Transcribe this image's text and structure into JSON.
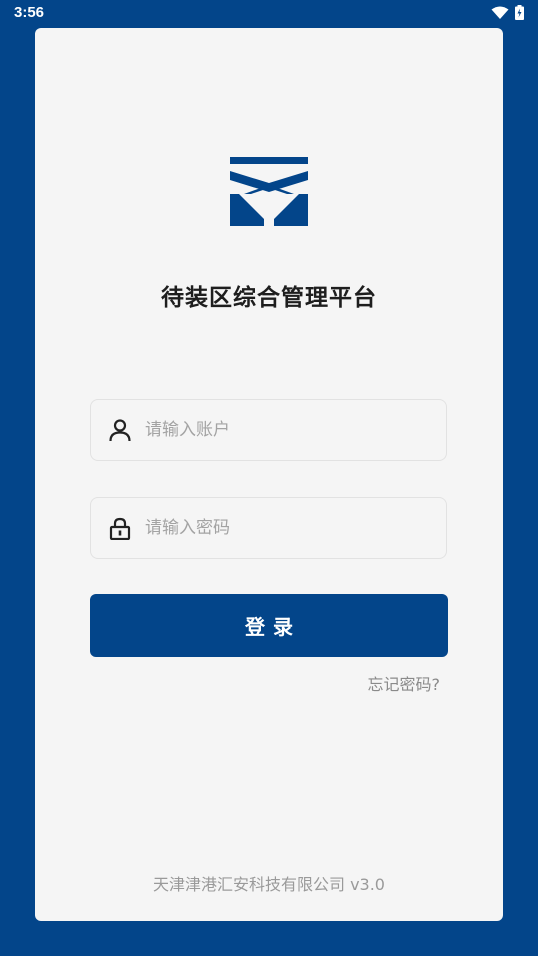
{
  "status_bar": {
    "time": "3:56"
  },
  "app": {
    "title": "待装区综合管理平台"
  },
  "login_form": {
    "account_placeholder": "请输入账户",
    "password_placeholder": "请输入密码",
    "login_label": "登录",
    "forgot_password_label": "忘记密码?"
  },
  "footer": {
    "company": "天津津港汇安科技有限公司 v3.0"
  },
  "colors": {
    "brand_blue": "#03458a",
    "card_background": "#f5f5f5",
    "placeholder_gray": "#a3a3a3"
  },
  "icons": {
    "account": "person-icon",
    "password": "lock-icon",
    "wifi": "wifi-icon",
    "battery": "battery-icon"
  }
}
